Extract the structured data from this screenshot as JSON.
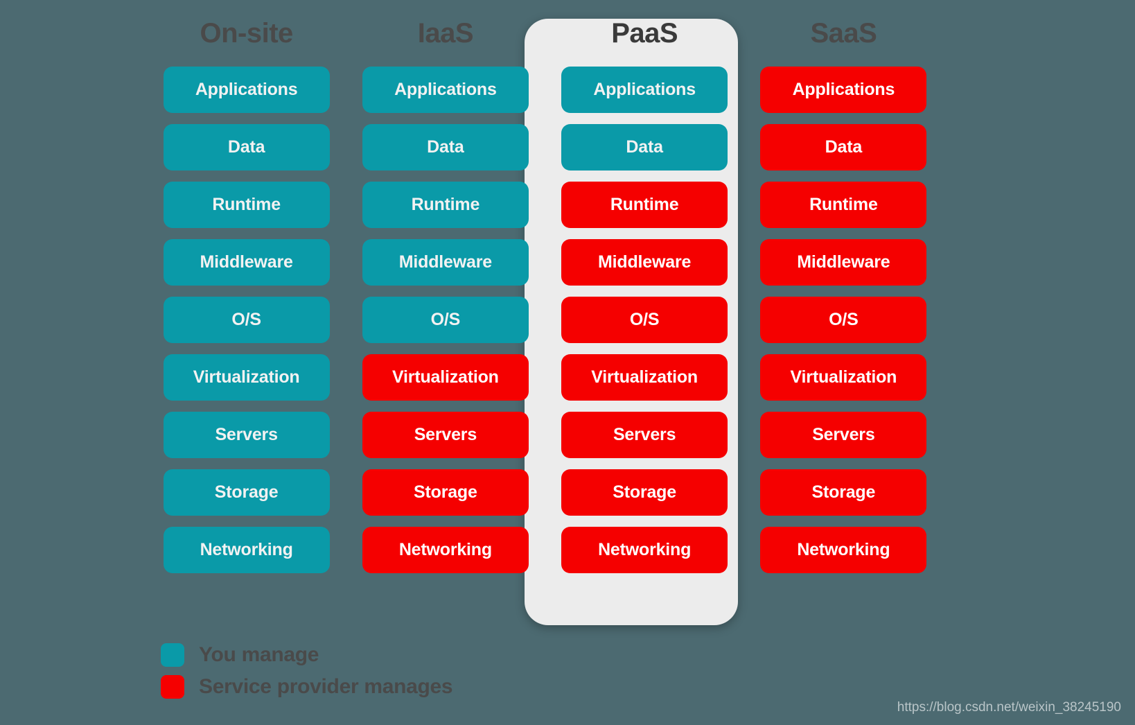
{
  "background_color": "#4c6a71",
  "colors": {
    "you_manage": "#0a9aa8",
    "provider_manages": "#f50000",
    "highlight_card": "#ececec",
    "header_text": "#4a4a4a",
    "pill_text": "#f2f2f2"
  },
  "layers": [
    "Applications",
    "Data",
    "Runtime",
    "Middleware",
    "O/S",
    "Virtualization",
    "Servers",
    "Storage",
    "Networking"
  ],
  "columns": [
    {
      "header": "On-site",
      "highlighted": false,
      "cells": [
        {
          "label": "Applications",
          "owner": "you"
        },
        {
          "label": "Data",
          "owner": "you"
        },
        {
          "label": "Runtime",
          "owner": "you"
        },
        {
          "label": "Middleware",
          "owner": "you"
        },
        {
          "label": "O/S",
          "owner": "you"
        },
        {
          "label": "Virtualization",
          "owner": "you"
        },
        {
          "label": "Servers",
          "owner": "you"
        },
        {
          "label": "Storage",
          "owner": "you"
        },
        {
          "label": "Networking",
          "owner": "you"
        }
      ]
    },
    {
      "header": "IaaS",
      "highlighted": false,
      "cells": [
        {
          "label": "Applications",
          "owner": "you"
        },
        {
          "label": "Data",
          "owner": "you"
        },
        {
          "label": "Runtime",
          "owner": "you"
        },
        {
          "label": "Middleware",
          "owner": "you"
        },
        {
          "label": "O/S",
          "owner": "you"
        },
        {
          "label": "Virtualization",
          "owner": "provider"
        },
        {
          "label": "Servers",
          "owner": "provider"
        },
        {
          "label": "Storage",
          "owner": "provider"
        },
        {
          "label": "Networking",
          "owner": "provider"
        }
      ]
    },
    {
      "header": "PaaS",
      "highlighted": true,
      "cells": [
        {
          "label": "Applications",
          "owner": "you"
        },
        {
          "label": "Data",
          "owner": "you"
        },
        {
          "label": "Runtime",
          "owner": "provider"
        },
        {
          "label": "Middleware",
          "owner": "provider"
        },
        {
          "label": "O/S",
          "owner": "provider"
        },
        {
          "label": "Virtualization",
          "owner": "provider"
        },
        {
          "label": "Servers",
          "owner": "provider"
        },
        {
          "label": "Storage",
          "owner": "provider"
        },
        {
          "label": "Networking",
          "owner": "provider"
        }
      ]
    },
    {
      "header": "SaaS",
      "highlighted": false,
      "cells": [
        {
          "label": "Applications",
          "owner": "provider"
        },
        {
          "label": "Data",
          "owner": "provider"
        },
        {
          "label": "Runtime",
          "owner": "provider"
        },
        {
          "label": "Middleware",
          "owner": "provider"
        },
        {
          "label": "O/S",
          "owner": "provider"
        },
        {
          "label": "Virtualization",
          "owner": "provider"
        },
        {
          "label": "Servers",
          "owner": "provider"
        },
        {
          "label": "Storage",
          "owner": "provider"
        },
        {
          "label": "Networking",
          "owner": "provider"
        }
      ]
    }
  ],
  "legend": [
    {
      "swatch": "you",
      "label": "You manage"
    },
    {
      "swatch": "provider",
      "label": "Service provider manages"
    }
  ],
  "watermark": {
    "text": "https://blog.csdn.net/weixin_38245190"
  }
}
